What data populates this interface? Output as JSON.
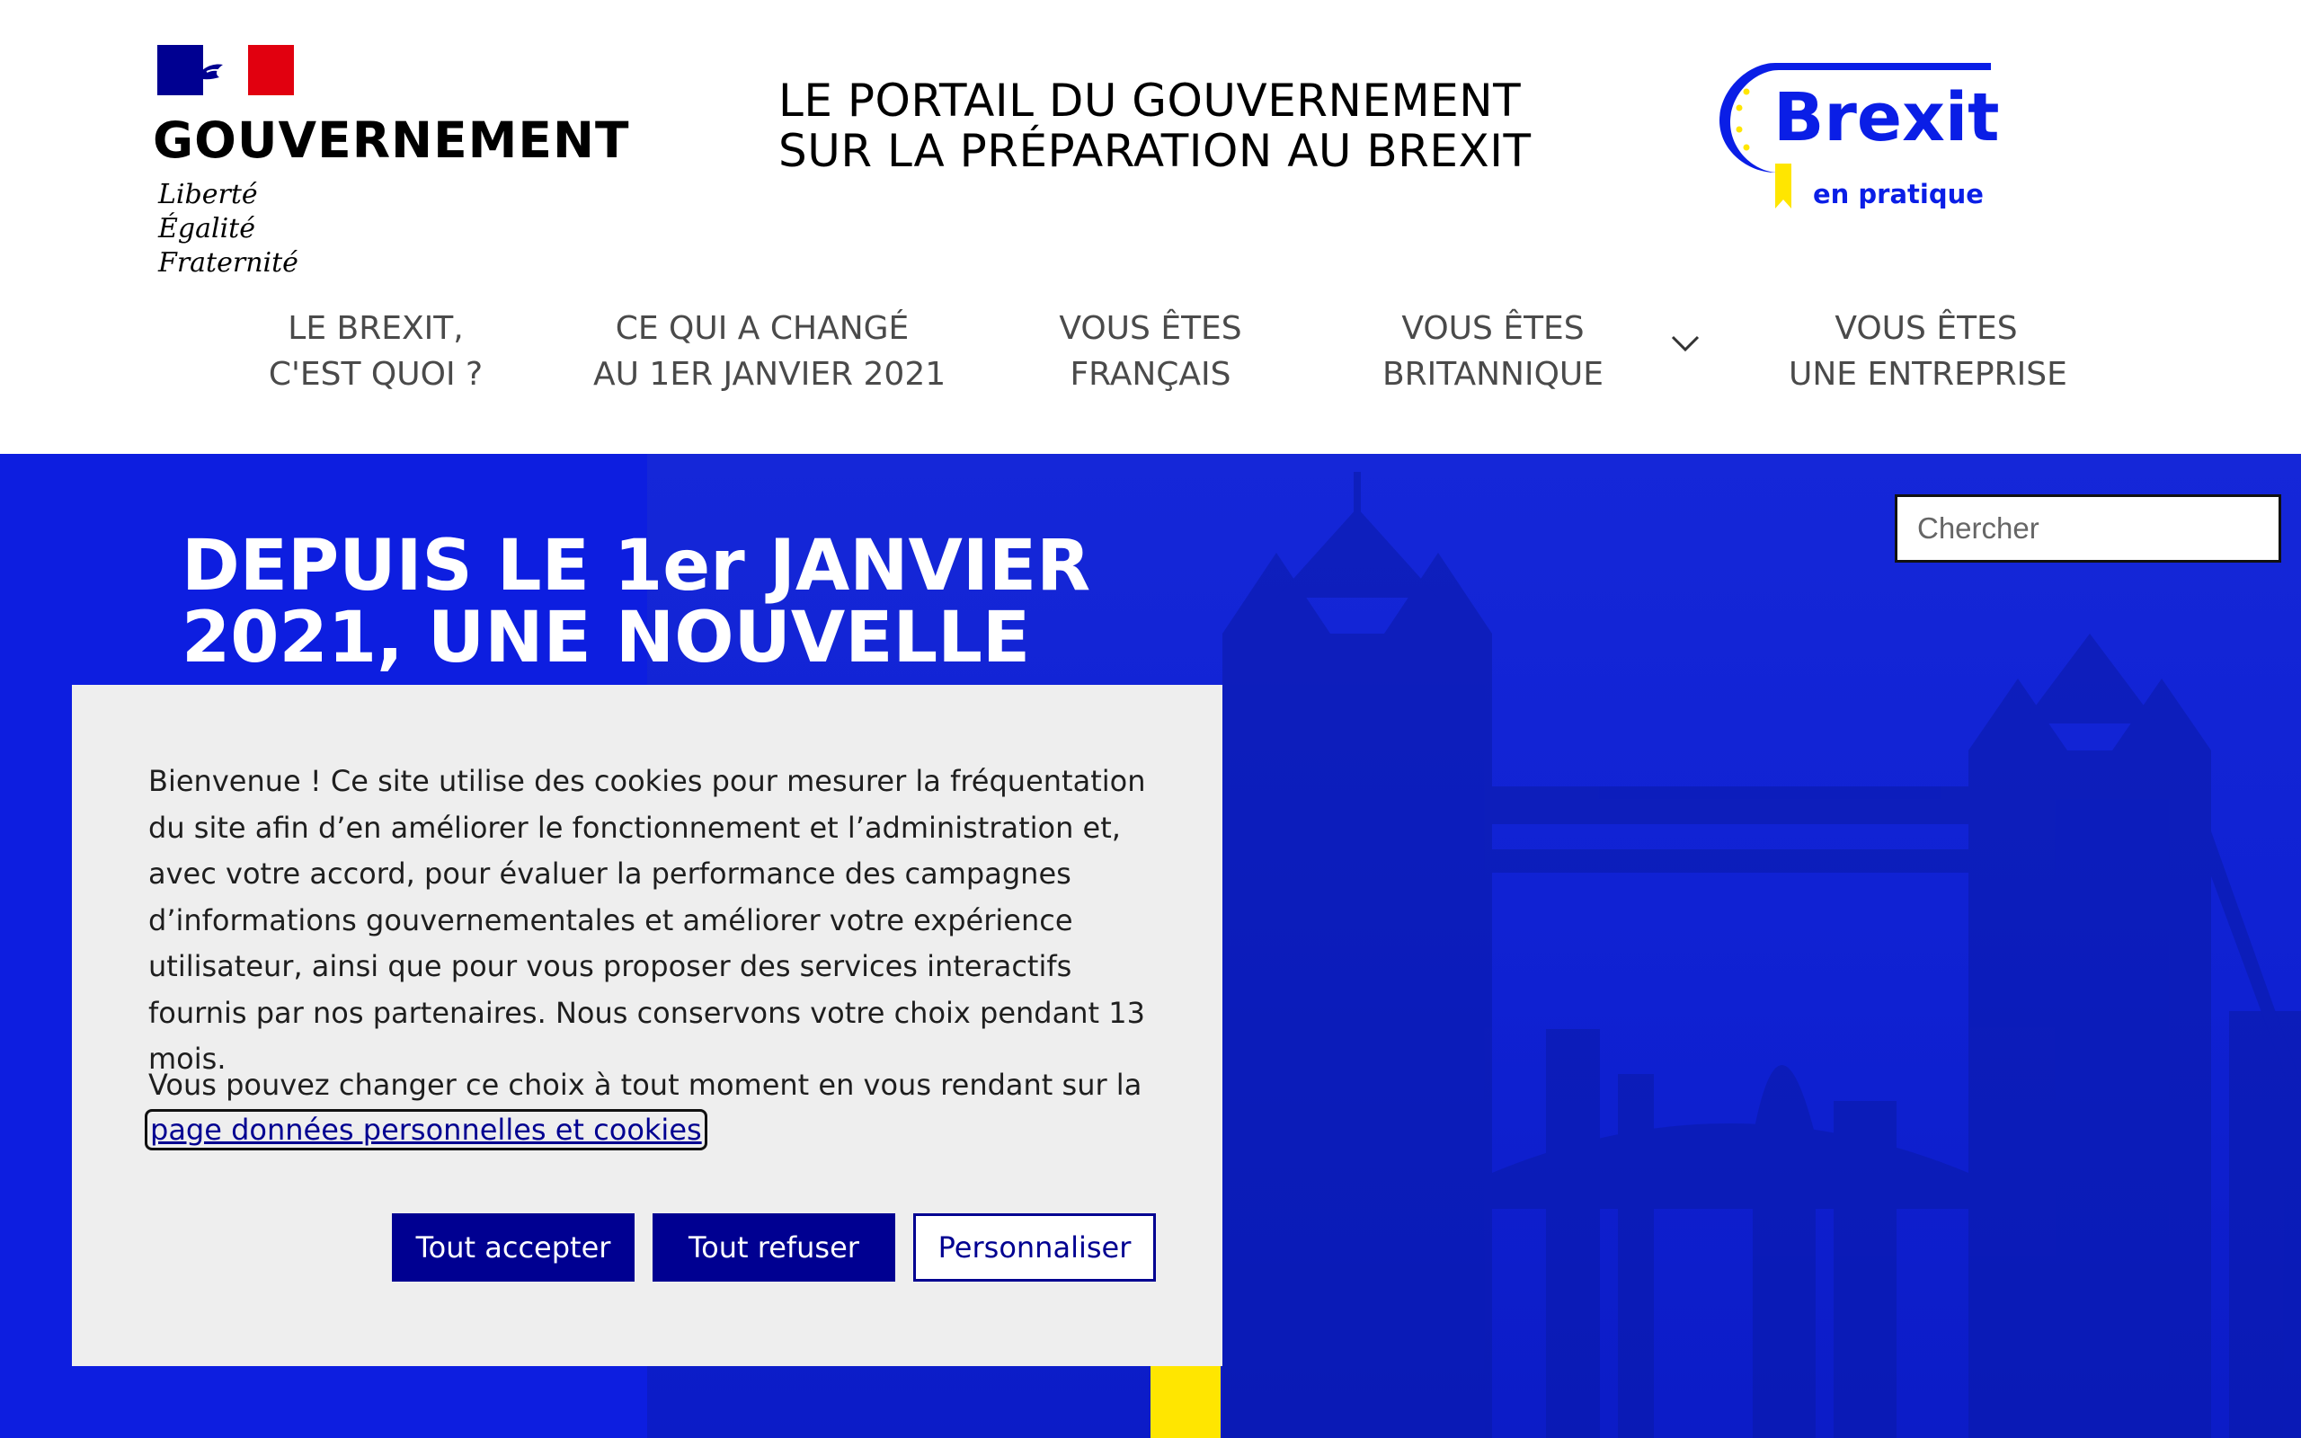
{
  "header": {
    "gov_logo": {
      "word": "GOUVERNEMENT",
      "motto": [
        "Liberté",
        "Égalité",
        "Fraternité"
      ]
    },
    "portal_title": [
      "LE PORTAIL DU GOUVERNEMENT",
      "SUR LA PRÉPARATION AU BREXIT"
    ],
    "brexit_logo": {
      "title": "Brexit",
      "subtitle": "en pratique"
    }
  },
  "nav": {
    "items": [
      {
        "line1": "LE BREXIT,",
        "line2": "C'EST QUOI ?"
      },
      {
        "line1": "CE QUI A CHANGÉ",
        "line2": "AU 1ER JANVIER 2021"
      },
      {
        "line1": "VOUS ÊTES",
        "line2": "FRANÇAIS"
      },
      {
        "line1": "VOUS ÊTES",
        "line2": "BRITANNIQUE"
      },
      {
        "line1": "VOUS ÊTES",
        "line2": "UNE ENTREPRISE"
      }
    ],
    "expand_icon": "chevron-down-icon"
  },
  "hero": {
    "title_line1": "DEPUIS LE 1er JANVIER",
    "title_line2": "2021, UNE NOUVELLE",
    "search": {
      "placeholder": "Chercher",
      "icon": "arrow-right-icon"
    }
  },
  "cookie_banner": {
    "text": "Bienvenue ! Ce site utilise des cookies pour mesurer la fréquentation du site afin d’en améliorer le fonctionnement et l’administration et, avec votre accord, pour évaluer la performance des campagnes d’informations gouvernementales et améliorer votre expérience utilisateur, ainsi que pour vous proposer des services interactifs fournis par nos partenaires. Nous conservons votre choix pendant 13 mois.",
    "text2": "Vous pouvez changer ce choix à tout moment en vous rendant sur la",
    "link": "page données personnelles et cookies",
    "buttons": {
      "accept": "Tout accepter",
      "refuse": "Tout refuser",
      "customize": "Personnaliser"
    }
  },
  "colors": {
    "gov_blue": "#000091",
    "hero_blue": "#0d1ee0",
    "flag_red": "#e1000f",
    "accent_yellow": "#ffe600",
    "banner_bg": "#eeeeee"
  }
}
